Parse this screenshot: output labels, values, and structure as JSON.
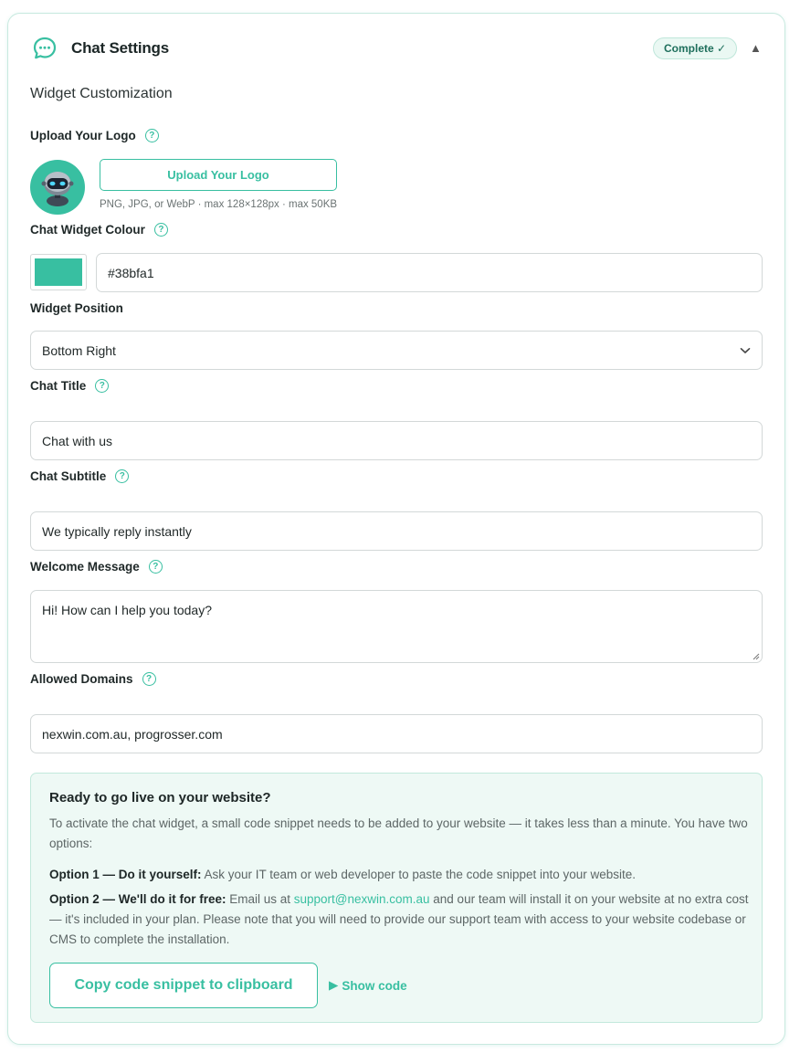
{
  "header": {
    "title": "Chat Settings",
    "status_badge": "Complete ✓",
    "collapse_glyph": "▲"
  },
  "section": {
    "title": "Widget Customization"
  },
  "logo": {
    "label": "Upload Your Logo",
    "button": "Upload Your Logo",
    "hint": "PNG, JPG, or WebP · max 128×128px · max 50KB"
  },
  "colour": {
    "label": "Chat Widget Colour",
    "value": "#38bfa1"
  },
  "position": {
    "label": "Widget Position",
    "selected": "Bottom Right"
  },
  "chat_title": {
    "label": "Chat Title",
    "value": "Chat with us"
  },
  "chat_subtitle": {
    "label": "Chat Subtitle",
    "value": "We typically reply instantly"
  },
  "welcome": {
    "label": "Welcome Message",
    "value": "Hi! How can I help you today?"
  },
  "domains": {
    "label": "Allowed Domains",
    "value": "nexwin.com.au, progrosser.com"
  },
  "golive": {
    "title": "Ready to go live on your website?",
    "intro": "To activate the chat widget, a small code snippet needs to be added to your website — it takes less than a minute. You have two options:",
    "option1_label": "Option 1 — Do it yourself:",
    "option1_text": " Ask your IT team or web developer to paste the code snippet into your website.",
    "option2_label": "Option 2 — We'll do it for free:",
    "option2_text_a": " Email us at ",
    "option2_email": "support@nexwin.com.au",
    "option2_text_b": " and our team will install it on your website at no extra cost — it's included in your plan. Please note that you will need to provide our support team with access to your website codebase or CMS to complete the installation.",
    "copy_button": "Copy code snippet to clipboard",
    "show_code": "Show code",
    "show_code_glyph": "▶"
  },
  "help_glyph": "?",
  "colors": {
    "accent": "#38bfa1",
    "badge_bg": "#eaf8f3",
    "panel_bg": "#eef9f5"
  },
  "icons": [
    "chat-bubble-icon",
    "help-icon",
    "robot-avatar-icon",
    "chevron-down-icon",
    "resize-handle-icon",
    "play-triangle-icon",
    "collapse-arrow-icon"
  ]
}
